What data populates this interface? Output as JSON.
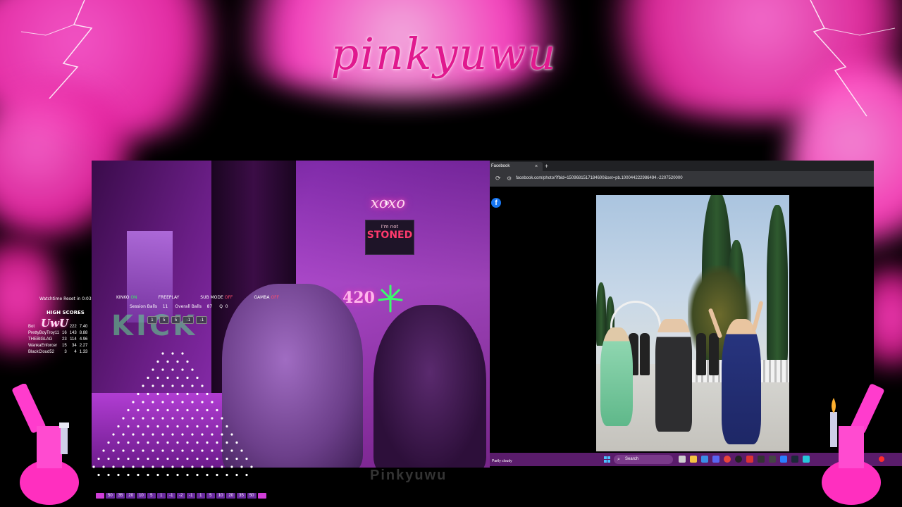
{
  "overlay": {
    "brand": "pinkyuwu",
    "watermark": "Pinkyuwu"
  },
  "webcam": {
    "signs": {
      "xoxo": "xoxo",
      "stoned_small": "I'm not",
      "stoned": "STONED",
      "n420": "420"
    },
    "kick_text": "KICK"
  },
  "hud": {
    "watchtime_label": "Watchtime Reset in 0:03",
    "kinko_label": "KINKO",
    "kinko_state": "ON",
    "freeplay": "FREEPLAY",
    "submode_label": "SUB MODE",
    "submode_state": "OFF",
    "gamba_label": "GAMBA",
    "gamba_state": "OFF",
    "session_balls_label": "Session Balls",
    "session_balls": "11",
    "overall_balls_label": "Overall Balls",
    "overall_balls": "87",
    "q_label": "Q",
    "q_value": "0",
    "badges": [
      "1",
      "5",
      "5",
      "-1",
      "-1"
    ],
    "high_scores_title": "HIGH SCORES",
    "high_scores_logo": "UwU",
    "high_scores": [
      {
        "name": "Bot",
        "a": "",
        "b": "222",
        "c": "7.40"
      },
      {
        "name": "PrettyBoyTroy11",
        "a": "16",
        "b": "143",
        "c": "8.88"
      },
      {
        "name": "THEBIGLAG",
        "a": "23",
        "b": "114",
        "c": "4.96"
      },
      {
        "name": "WankaEnforcer",
        "a": "15",
        "b": "34",
        "c": "2.27"
      },
      {
        "name": "BlackCloud52",
        "a": "3",
        "b": "4",
        "c": "1.33"
      }
    ]
  },
  "plinko": {
    "slots": [
      "",
      "50",
      "35",
      "20",
      "10",
      "5",
      "1",
      "-1",
      "-2",
      "-1",
      "1",
      "5",
      "10",
      "20",
      "35",
      "50",
      ""
    ]
  },
  "browser": {
    "tab_title": "Facebook",
    "tab_close": "×",
    "new_tab": "+",
    "reload": "⟳",
    "url": "facebook.com/photo/?fbid=1509681517184600&set=pb.100044222986494.-2207520000",
    "zoom_icon": "⊕"
  },
  "taskbar": {
    "weather": "Partly cloudy",
    "search_placeholder": "Search"
  },
  "colors": {
    "brand_pink": "#e0198e",
    "taskbar": "#5a1c6b",
    "on": "#3fe26b",
    "off": "#ff4d6d"
  }
}
